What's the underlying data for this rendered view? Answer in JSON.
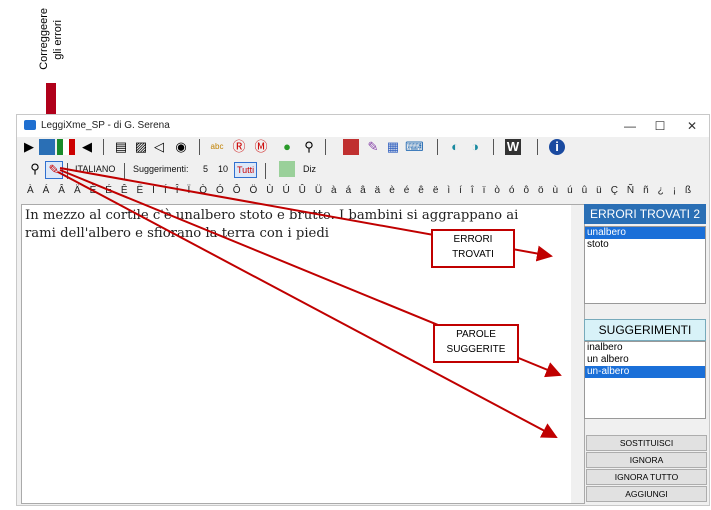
{
  "annotation": {
    "top_label_line1": "Correggeere",
    "top_label_line2": "gli errori"
  },
  "window": {
    "title": "LeggiXme_SP - di G. Serena",
    "minimize": "—",
    "maximize": "☐",
    "close": "✕"
  },
  "toolbar2": {
    "language": "ITALIANO",
    "suggestions_label": "Suggerimenti:",
    "opt5": "5",
    "opt10": "10",
    "opt_all": "Tutti",
    "diz": "Diz"
  },
  "accent_chars": "À Á Â Ä È É Ê Ë Ì Í Î Ï Ò Ó Ô Ö Ù Ú Û Ü à á â ä è é ê ë ì í î ï ò ó ô ö ù ú û ü Ç Ñ ñ ¿ ¡ ß",
  "editor": {
    "line1": "In mezzo al cortile c'è unalbero stoto e brutto. I bambini si aggrappano ai",
    "line2": "rami dell'albero e sfiorano la terra con i piedi"
  },
  "errors_panel": {
    "header": "ERRORI TROVATI 2",
    "items": [
      "unalbero",
      "stoto"
    ]
  },
  "suggestions_panel": {
    "header": "SUGGERIMENTI",
    "items": [
      "inalbero",
      "un albero",
      "un-albero"
    ]
  },
  "buttons": {
    "replace": "SOSTITUISCI",
    "ignore": "IGNORA",
    "ignore_all": "IGNORA TUTTO",
    "add": "AGGIUNGI"
  },
  "callouts": {
    "errors": "ERRORI TROVATI",
    "suggestions": "PAROLE SUGGERITE"
  },
  "colors": {
    "accent": "#c00000",
    "selection": "#1a6fd8",
    "panel_header": "#2a6fb5"
  }
}
